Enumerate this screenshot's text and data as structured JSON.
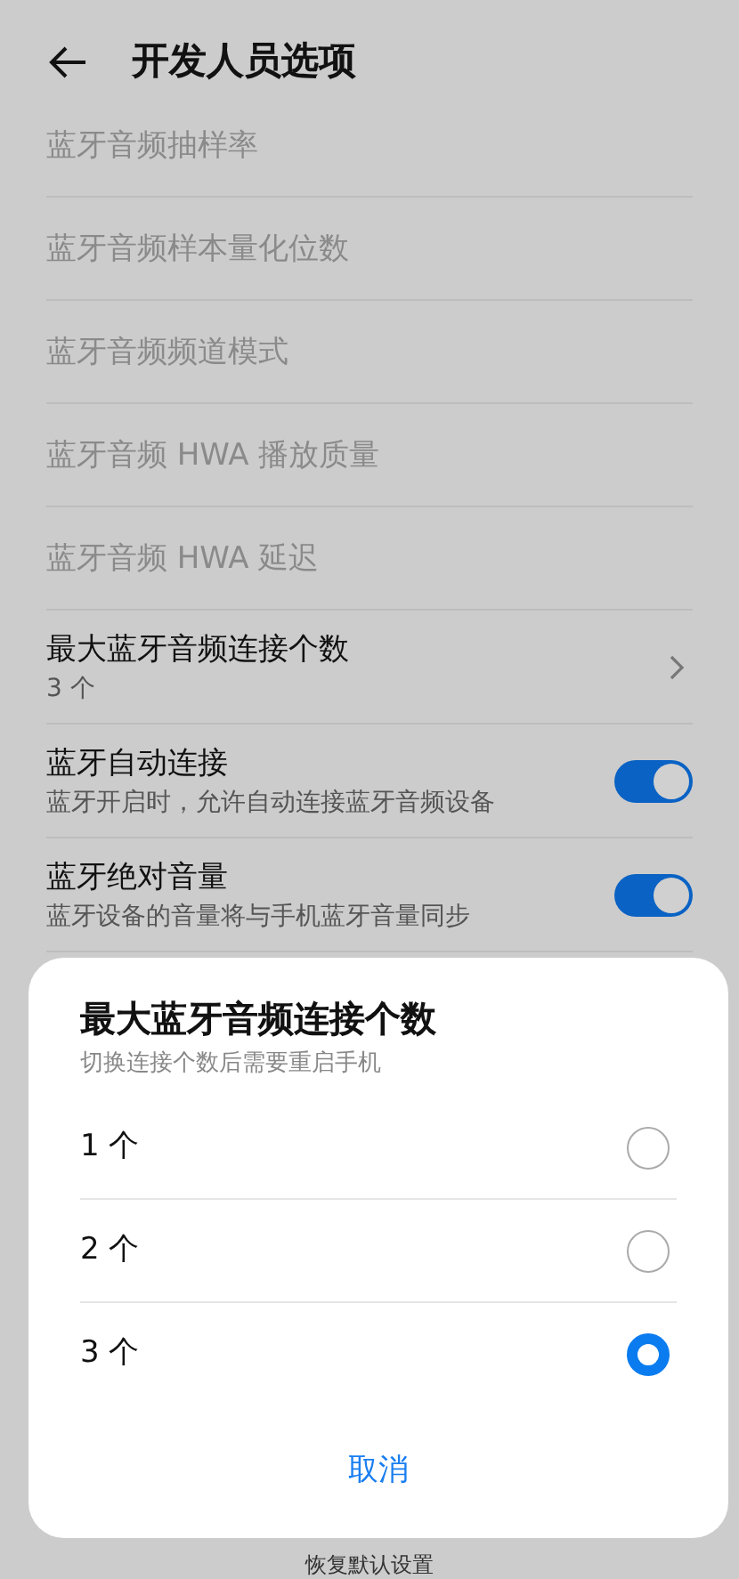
{
  "header": {
    "title": "开发人员选项"
  },
  "settings": [
    {
      "kind": "plain",
      "title": "蓝牙音频抽样率",
      "disabled": true
    },
    {
      "kind": "plain",
      "title": "蓝牙音频样本量化位数",
      "disabled": true
    },
    {
      "kind": "plain",
      "title": "蓝牙音频频道模式",
      "disabled": true
    },
    {
      "kind": "plain",
      "title": "蓝牙音频 HWA 播放质量",
      "disabled": true
    },
    {
      "kind": "plain",
      "title": "蓝牙音频 HWA 延迟",
      "disabled": true
    },
    {
      "kind": "link",
      "title": "最大蓝牙音频连接个数",
      "value": "3 个",
      "disabled": false
    },
    {
      "kind": "toggle",
      "title": "蓝牙自动连接",
      "subtitle": "蓝牙开启时，允许自动连接蓝牙音频设备",
      "on": true,
      "disabled": false
    },
    {
      "kind": "toggle",
      "title": "蓝牙绝对音量",
      "subtitle": "蓝牙设备的音量将与手机蓝牙音量同步",
      "on": true,
      "disabled": false
    }
  ],
  "footer_button": "恢复默认设置",
  "dialog": {
    "title": "最大蓝牙音频连接个数",
    "subtitle": "切换连接个数后需要重启手机",
    "options": [
      {
        "label": "1 个",
        "selected": false
      },
      {
        "label": "2 个",
        "selected": false
      },
      {
        "label": "3 个",
        "selected": true
      }
    ],
    "cancel": "取消"
  }
}
